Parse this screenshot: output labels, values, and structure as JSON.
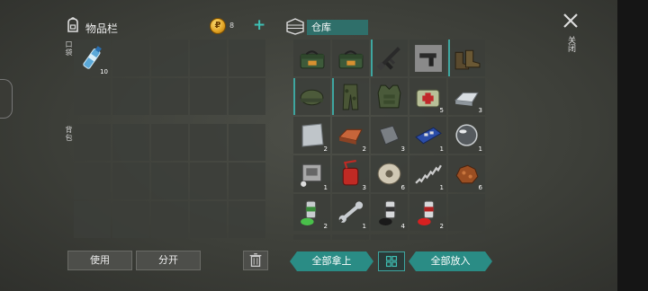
{
  "inventory": {
    "title": "物品栏",
    "coins": "8",
    "coin_symbol": "₽",
    "plus": "+",
    "pocket_label": "口袋",
    "backpack_label": "背包",
    "pocket_items": [
      {
        "icon": "water-bottle-icon",
        "qty": "10"
      },
      {
        "icon": "",
        "qty": ""
      },
      {
        "icon": "",
        "qty": ""
      },
      {
        "icon": "",
        "qty": ""
      },
      {
        "icon": "",
        "qty": ""
      },
      {
        "icon": "",
        "qty": ""
      },
      {
        "icon": "",
        "qty": ""
      },
      {
        "icon": "",
        "qty": ""
      },
      {
        "icon": "",
        "qty": ""
      },
      {
        "icon": "",
        "qty": ""
      }
    ],
    "use_button": "使用",
    "split_button": "分开"
  },
  "warehouse": {
    "title": "仓库",
    "take_all_button": "全部拿上",
    "put_all_button": "全部放入",
    "items": [
      {
        "icon": "ammo-box-icon",
        "qty": ""
      },
      {
        "icon": "ammo-box-icon",
        "qty": ""
      },
      {
        "icon": "assault-rifle-icon",
        "qty": ""
      },
      {
        "icon": "pistol-icon",
        "qty": ""
      },
      {
        "icon": "boots-icon",
        "qty": ""
      },
      {
        "icon": "helmet-icon",
        "qty": ""
      },
      {
        "icon": "camo-pants-icon",
        "qty": ""
      },
      {
        "icon": "body-armor-icon",
        "qty": ""
      },
      {
        "icon": "medkit-icon",
        "qty": "5"
      },
      {
        "icon": "steel-ingot-icon",
        "qty": "3"
      },
      {
        "icon": "metal-plate-icon",
        "qty": "2"
      },
      {
        "icon": "copper-ingot-icon",
        "qty": "2"
      },
      {
        "icon": "steel-block-icon",
        "qty": "3"
      },
      {
        "icon": "circuit-board-icon",
        "qty": "1"
      },
      {
        "icon": "glass-lens-icon",
        "qty": "1"
      },
      {
        "icon": "engine-part-icon",
        "qty": "1"
      },
      {
        "icon": "fuel-can-icon",
        "qty": "3"
      },
      {
        "icon": "wire-spool-icon",
        "qty": "6"
      },
      {
        "icon": "spring-icon",
        "qty": "1"
      },
      {
        "icon": "copper-ore-icon",
        "qty": "6"
      },
      {
        "icon": "green-paint-icon",
        "qty": "2"
      },
      {
        "icon": "wrench-icon",
        "qty": "1"
      },
      {
        "icon": "black-paint-icon",
        "qty": "4"
      },
      {
        "icon": "red-paint-icon",
        "qty": "2"
      },
      {
        "icon": "",
        "qty": ""
      }
    ]
  },
  "close": {
    "icon": "close-icon",
    "label": "关闭"
  },
  "colors": {
    "accent": "#3ea6a0",
    "panel_cell": "#3c3e3a",
    "button": "#2a8c85"
  }
}
